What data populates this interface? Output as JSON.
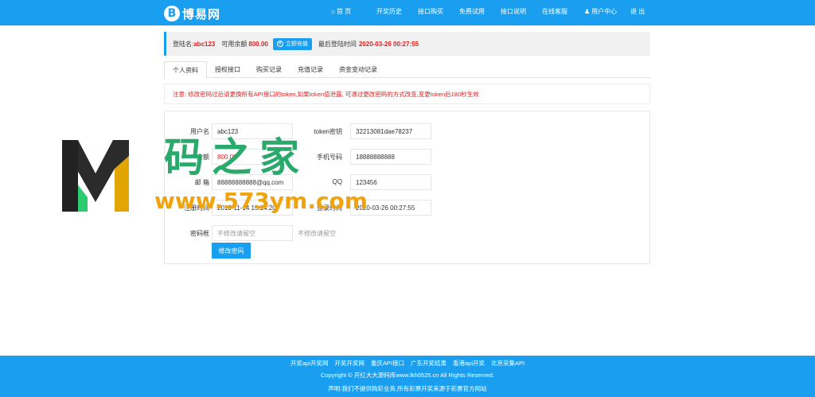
{
  "header": {
    "logo_badge": "B",
    "logo_text": "博易网",
    "nav": [
      {
        "label": "首 页",
        "icon": "home-icon"
      },
      {
        "label": "开奖历史"
      },
      {
        "label": "接口购买"
      },
      {
        "label": "免费试用"
      },
      {
        "label": "接口说明"
      },
      {
        "label": "在线客服"
      },
      {
        "label": "用户中心",
        "icon": "user-icon"
      },
      {
        "label": "退 出"
      }
    ]
  },
  "infobar": {
    "login_label": "登陆名:",
    "login_value": "abc123",
    "balance_label": "可用余额",
    "balance_value": "800.00",
    "recharge_button": "立即充值",
    "last_login_label": "最后登陆时间",
    "last_login_value": "2020-03-26 00:27:55"
  },
  "tabs": [
    "个人资料",
    "授权接口",
    "购买记录",
    "充值记录",
    "资金变动记录"
  ],
  "notice": "注意: 修改密码过后请更换所有API接口的token,如果token值泄露, 可通过更改密码的方式改变,变更token后180秒生效",
  "form": {
    "username_label": "用户名",
    "username_value": "abc123",
    "token_label": "token密钥",
    "token_value": "32213081dae78237",
    "balance_label": "余额",
    "balance_value": "800.00",
    "phone_label": "手机号码",
    "phone_value": "18888888888",
    "email_label": "邮 箱",
    "email_value": "88888888888@qq.com",
    "qq_label": "QQ",
    "qq_value": "123456",
    "register_label": "注册时间",
    "register_value": "2019-11-14 15:14:20",
    "lastlogin_label": "登录时间",
    "lastlogin_value": "2020-03-26 00:27:55",
    "password_label": "密码框",
    "password_placeholder": "不修改请留空",
    "password_hint": "不修改请留空",
    "submit": "修改密码"
  },
  "watermark": {
    "letter": "M",
    "cn": "码之家",
    "url": "www.573ym.com"
  },
  "footer": {
    "links": [
      "开奖api开奖网",
      "开奖开奖网",
      "重庆API接口",
      "广东开奖结果",
      "香港api开奖",
      "北京采集API"
    ],
    "copyright": "Copyright © 开红大大源码库www.lkh0525.cn All Rights Reserved.",
    "disclaimer": "声明:我们不提供购彩业务,所有彩票开奖来源于彩票官方网站"
  },
  "colors": {
    "primary": "#1a9ff0",
    "red": "#e02020",
    "watermark_green": "#29a96b",
    "watermark_orange": "#f0a30a"
  }
}
